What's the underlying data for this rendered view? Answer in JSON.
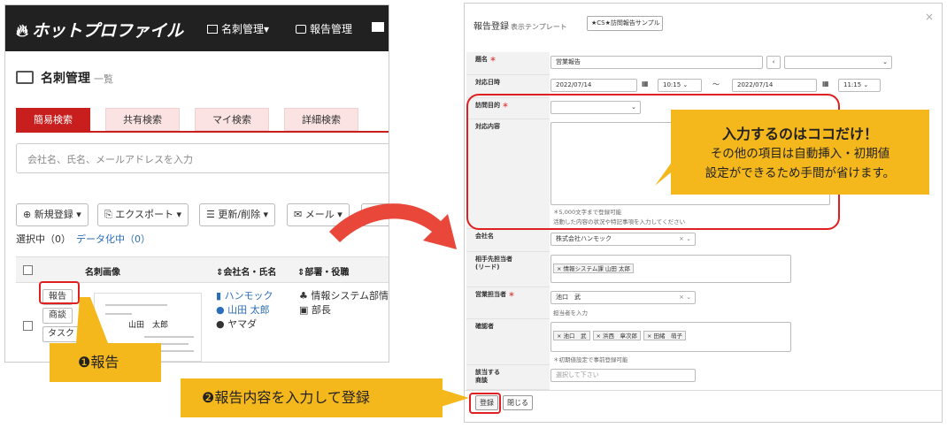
{
  "left": {
    "logo": "ホットプロファイル",
    "nav": [
      "名刺管理▾",
      "報告管理"
    ],
    "page_title": "名刺管理",
    "page_sub": "一覧",
    "tabs": [
      "簡易検索",
      "共有検索",
      "マイ検索",
      "詳細検索"
    ],
    "search_placeholder": "会社名、氏名、メールアドレスを入力",
    "toolbar": [
      "新規登録 ▾",
      "エクスポート ▾",
      "更新/削除 ▾",
      "メール ▾"
    ],
    "selected": "選択中（0）",
    "dataize": "データ化中（0）",
    "columns": {
      "image": "名刺画像",
      "company": "会社名・氏名",
      "dept": "部署・役職"
    },
    "row": {
      "btn_report": "報告",
      "btn_meet": "商談",
      "btn_task": "タスク",
      "company": "ハンモック",
      "name": "山田 太郎",
      "kana": "ヤマダ",
      "dept": "情報システム部情",
      "title": "部長",
      "card_name": "山田　太郎"
    }
  },
  "dialog": {
    "title": "報告登録",
    "tpl_label": "表示テンプレート",
    "tpl_value": "★CS★訪問報告サンプル【削除",
    "f_subject": {
      "label": "題名",
      "value": "営業報告"
    },
    "f_datetime": {
      "label": "対応日時",
      "date1": "2022/07/14",
      "time1": "10:15",
      "date2": "2022/07/14",
      "time2": "11:15",
      "sep": "〜"
    },
    "f_purpose": {
      "label": "訪問目的"
    },
    "f_content": {
      "label": "対応内容",
      "hint1": "＊5,000文字まで登録可能",
      "hint2": "活動した内容の状況や特記事項を入力してください"
    },
    "f_company": {
      "label": "会社名",
      "value": "株式会社ハンモック"
    },
    "f_contact": {
      "label": "相手先担当者\n(リード)",
      "chip": "情報システム課 山田 太郎"
    },
    "f_sales": {
      "label": "営業担当者",
      "value": "池口　武",
      "hint": "担当者を入力"
    },
    "f_approver": {
      "label": "確認者",
      "chips": [
        "池口　武",
        "浜西　章次郎",
        "田緒　萌子"
      ],
      "hint": "＊初期値設定で事前登録可能"
    },
    "f_deal": {
      "label": "該当する\n商談",
      "placeholder": "選択して下さい"
    },
    "btn_register": "登録",
    "btn_close": "閉じる"
  },
  "annotations": {
    "c1": "❶報告",
    "c2": "❷報告内容を入力して登録",
    "c3_title": "入力するのはココだけ！",
    "c3_l1": "その他の項目は自動挿入・初期値",
    "c3_l2": "設定ができるため手間が省けます。"
  },
  "colors": {
    "brand_red": "#c81e1e",
    "callout": "#f5b81c",
    "annot_red": "#e02020",
    "arrow": "#e8473a"
  }
}
